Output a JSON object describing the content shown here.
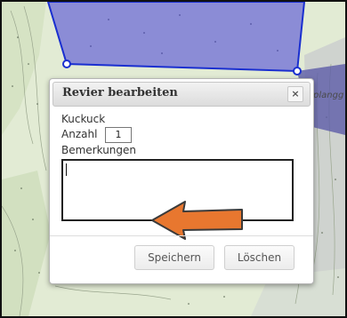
{
  "dialog": {
    "title": "Revier bearbeiten",
    "close_symbol": "×",
    "field_name": "Kuckuck",
    "count_label": "Anzahl",
    "count_value": "1",
    "remarks_label": "Bemerkungen",
    "remarks_value": "",
    "save_label": "Speichern",
    "delete_label": "Löschen"
  },
  "map": {
    "label_top_right": "plangg",
    "polygon_fill": "#7b7bd6",
    "polygon_stroke": "#1a2fd0"
  },
  "colors": {
    "arrow_fill": "#e8772f",
    "arrow_stroke": "#3a3a3a"
  }
}
